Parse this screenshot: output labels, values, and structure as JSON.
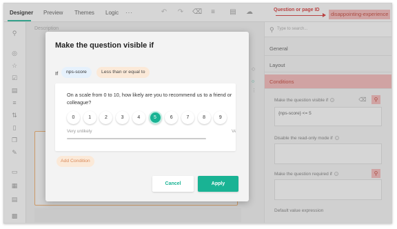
{
  "topbar": {
    "tabs": [
      "Designer",
      "Preview",
      "Themes",
      "Logic"
    ],
    "more": "···",
    "page_id_label": "Question or page ID",
    "page_id_value": "disappointing-experience"
  },
  "canvas": {
    "description_placeholder": "Description"
  },
  "sidebar": {
    "search_placeholder": "Type to search...",
    "sections": {
      "general": "General",
      "layout": "Layout",
      "conditions": "Conditions"
    },
    "props": {
      "visible_if_label": "Make the question visible if",
      "visible_if_value": "{nps-score} <= 5",
      "readonly_if_label": "Disable the read-only mode if",
      "required_if_label": "Make the question required if",
      "default_expr_label": "Default value expression"
    },
    "help_glyph": "?"
  },
  "modal": {
    "title": "Make the question visible if",
    "if_label": "If",
    "question_chip": "nps-score",
    "operator_chip": "Less than or equal to",
    "preview": {
      "question": "On a scale from 0 to 10, how likely are you to recommend us to a friend or colleague?",
      "rates": [
        "0",
        "1",
        "2",
        "3",
        "4",
        "5",
        "6",
        "7",
        "8",
        "9"
      ],
      "selected_value": "5",
      "min_label": "Very unlikely",
      "max_label": "Ve"
    },
    "add_condition": "Add Condition",
    "cancel": "Cancel",
    "apply": "Apply"
  }
}
